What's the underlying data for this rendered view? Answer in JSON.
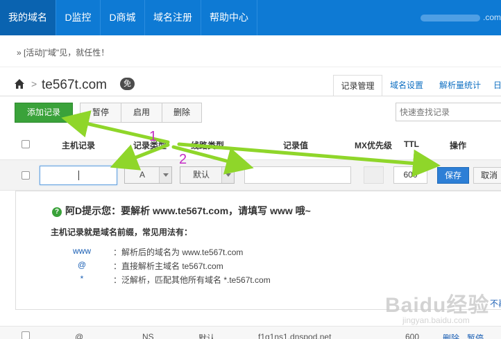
{
  "nav": {
    "tabs": [
      {
        "label": "我的域名",
        "active": true
      },
      {
        "label": "D监控"
      },
      {
        "label": "D商城"
      },
      {
        "label": "域名注册"
      },
      {
        "label": "帮助中心"
      }
    ],
    "user_suffix": ".com"
  },
  "notice": "» [活动]\"域\"见，就任性！",
  "domain": {
    "name": "te567t.com",
    "badge": "免"
  },
  "tabs": [
    {
      "label": "记录管理",
      "active": true
    },
    {
      "label": "域名设置"
    },
    {
      "label": "解析量统计"
    },
    {
      "label": "日"
    }
  ],
  "toolbar": {
    "add_label": "添加记录",
    "pause_label": "暂停",
    "enable_label": "启用",
    "delete_label": "删除",
    "search_placeholder": "快速查找记录"
  },
  "table": {
    "headers": [
      "主机记录",
      "记录类型",
      "线路类型",
      "记录值",
      "MX优先级",
      "TTL",
      "操作"
    ]
  },
  "edit_row": {
    "host_value": "",
    "type_value": "A",
    "line_value": "默认",
    "value": "",
    "mx": "",
    "ttl": "600",
    "save_label": "保存",
    "cancel_label": "取消"
  },
  "tip": {
    "title": "阿D提示您：要解析 www.te567t.com，请填写 www 哦~",
    "subtitle": "主机记录就是域名前缀，常见用法有：",
    "examples": [
      {
        "key": "www",
        "desc": "：解析后的域名为 www.te567t.com"
      },
      {
        "key": "@",
        "desc": "：直接解析主域名 te567t.com"
      },
      {
        "key": "*",
        "desc": "：泛解析，匹配其他所有域名 *.te567t.com"
      }
    ],
    "more": "不再"
  },
  "bottom_row": {
    "host": "@",
    "type": "NS",
    "line": "默认",
    "value": "f1g1ns1.dnspod.net",
    "ttl": "600",
    "delete": "删除",
    "pause": "暂停"
  },
  "annotations": {
    "n1": "1",
    "n2": "2",
    "color": "#c42cc4",
    "arrow_color": "#8fd62a"
  },
  "watermark": {
    "logo": "Baidu经验",
    "url": "jingyan.baidu.com"
  }
}
